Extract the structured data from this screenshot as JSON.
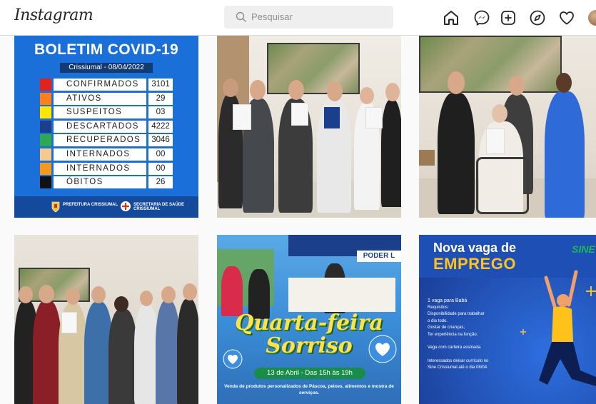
{
  "header": {
    "logo": "Instagram",
    "search_placeholder": "Pesquisar"
  },
  "nav_icons": [
    "home-icon",
    "messenger-icon",
    "new-post-icon",
    "explore-icon",
    "activity-heart-icon",
    "profile-avatar"
  ],
  "posts": {
    "covid": {
      "title": "BOLETIM COVID-19",
      "date": "Crissiumal - 08/04/2022",
      "rows": [
        {
          "label": "CONFIRMADOS",
          "value": "3101",
          "color": "#e0231c"
        },
        {
          "label": "ATIVOS",
          "value": "29",
          "color": "#ff7f1a"
        },
        {
          "label": "SUSPEITOS",
          "value": "03",
          "color": "#ffe600"
        },
        {
          "label": "DESCARTADOS",
          "value": "4222",
          "color": "#1c3f8c"
        },
        {
          "label": "RECUPERADOS",
          "value": "3046",
          "color": "#2fa84f"
        },
        {
          "label": "INTERNADOS",
          "value": "00",
          "color": "#f8c98c"
        },
        {
          "label": "INTERNADOS UTI",
          "value": "00",
          "color": "#f39a1e"
        },
        {
          "label": "ÓBITOS",
          "value": "26",
          "color": "#111111"
        }
      ],
      "footer_left": "PREFEITURA CRISSIUMAL",
      "footer_right": "SECRETARIA DE SAÚDE CRISSIUMAL"
    },
    "quarta": {
      "title_line1": "Quarta-feira",
      "title_line2": "Sorriso",
      "badge": "13 de Abril - Das 15h às 19h",
      "footer": "Venda de produtos personalizados de Páscoa, peixes, alimentos e mostra de serviços.",
      "sign": "PODER L"
    },
    "emprego": {
      "title_line1": "Nova vaga de",
      "title_line2": "EMPREGO",
      "brand": "SINE",
      "lines": [
        "1 vaga para Babá",
        "Requisitos:",
        "Disponibilidade para trabalhar",
        "o dia todo.",
        "Gostar de crianças;",
        "Ter experiência na função.",
        "",
        "Vaga com carteira assinada.",
        "",
        "Interessados deixar currículo no",
        "Sine Crissiumal até o dia 08/04."
      ]
    }
  }
}
